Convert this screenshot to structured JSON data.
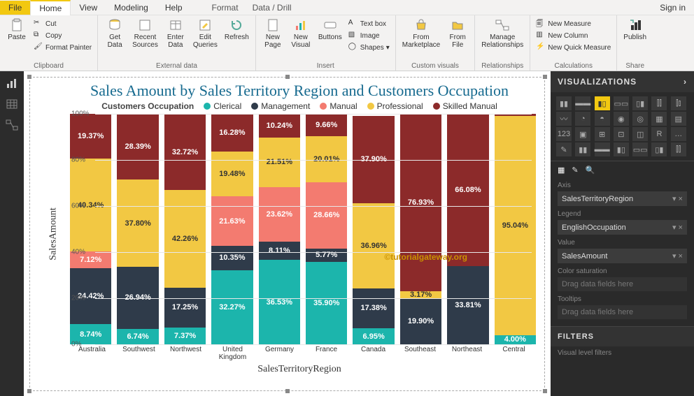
{
  "menubar": {
    "file": "File",
    "tabs": [
      "Home",
      "View",
      "Modeling",
      "Help"
    ],
    "subtabs": [
      "Format",
      "Data / Drill"
    ],
    "signin": "Sign in"
  },
  "ribbon": {
    "clipboard": {
      "label": "Clipboard",
      "paste": "Paste",
      "cut": "Cut",
      "copy": "Copy",
      "format_painter": "Format Painter"
    },
    "external": {
      "label": "External data",
      "get_data": "Get\nData",
      "recent": "Recent\nSources",
      "enter": "Enter\nData",
      "edit": "Edit\nQueries",
      "refresh": "Refresh"
    },
    "insert": {
      "label": "Insert",
      "new_page": "New\nPage",
      "new_visual": "New\nVisual",
      "buttons": "Buttons",
      "textbox": "Text box",
      "image": "Image",
      "shapes": "Shapes"
    },
    "custom": {
      "label": "Custom visuals",
      "marketplace": "From\nMarketplace",
      "file": "From\nFile"
    },
    "relationships": {
      "label": "Relationships",
      "manage": "Manage\nRelationships"
    },
    "calculations": {
      "label": "Calculations",
      "measure": "New Measure",
      "column": "New Column",
      "quick": "New Quick Measure"
    },
    "share": {
      "label": "Share",
      "publish": "Publish"
    }
  },
  "chart_data": {
    "type": "bar",
    "title": "Sales Amount by Sales Territory Region and Customers Occupation",
    "legend_title": "Customers Occupation",
    "xlabel": "SalesTerritoryRegion",
    "ylabel": "SalesAmount",
    "ylim": [
      0,
      100
    ],
    "yticks": [
      0,
      20,
      40,
      60,
      80,
      100
    ],
    "categories": [
      "Australia",
      "Southwest",
      "Northwest",
      "United Kingdom",
      "Germany",
      "France",
      "Canada",
      "Southeast",
      "Northeast",
      "Central"
    ],
    "series": [
      {
        "name": "Clerical",
        "color": "#1cb5ac",
        "values": [
          8.74,
          6.74,
          7.37,
          32.27,
          36.53,
          35.9,
          6.95,
          0,
          0,
          4.0
        ]
      },
      {
        "name": "Management",
        "color": "#2f3b4a",
        "values": [
          24.42,
          26.94,
          17.25,
          10.35,
          8.11,
          5.77,
          17.38,
          19.9,
          33.81,
          0
        ]
      },
      {
        "name": "Manual",
        "color": "#f37b70",
        "values": [
          7.12,
          0,
          0,
          21.63,
          23.62,
          28.66,
          0,
          0,
          0,
          0
        ]
      },
      {
        "name": "Professional",
        "color": "#f2c843",
        "values": [
          40.34,
          37.8,
          42.26,
          19.48,
          21.51,
          20.01,
          36.96,
          3.17,
          0,
          95.04
        ]
      },
      {
        "name": "Skilled Manual",
        "color": "#8c2a2a",
        "values": [
          19.37,
          28.39,
          32.72,
          16.28,
          10.24,
          9.66,
          37.9,
          76.93,
          66.08,
          0.96
        ]
      }
    ],
    "watermark": "©tutorialgateway.org"
  },
  "visualizations": {
    "title": "VISUALIZATIONS",
    "fields": {
      "axis": {
        "label": "Axis",
        "value": "SalesTerritoryRegion"
      },
      "legend": {
        "label": "Legend",
        "value": "EnglishOccupation"
      },
      "value": {
        "label": "Value",
        "value": "SalesAmount"
      },
      "color_sat": {
        "label": "Color saturation",
        "placeholder": "Drag data fields here"
      },
      "tooltips": {
        "label": "Tooltips",
        "placeholder": "Drag data fields here"
      }
    }
  },
  "filters": {
    "title": "FILTERS",
    "sub": "Visual level filters"
  }
}
